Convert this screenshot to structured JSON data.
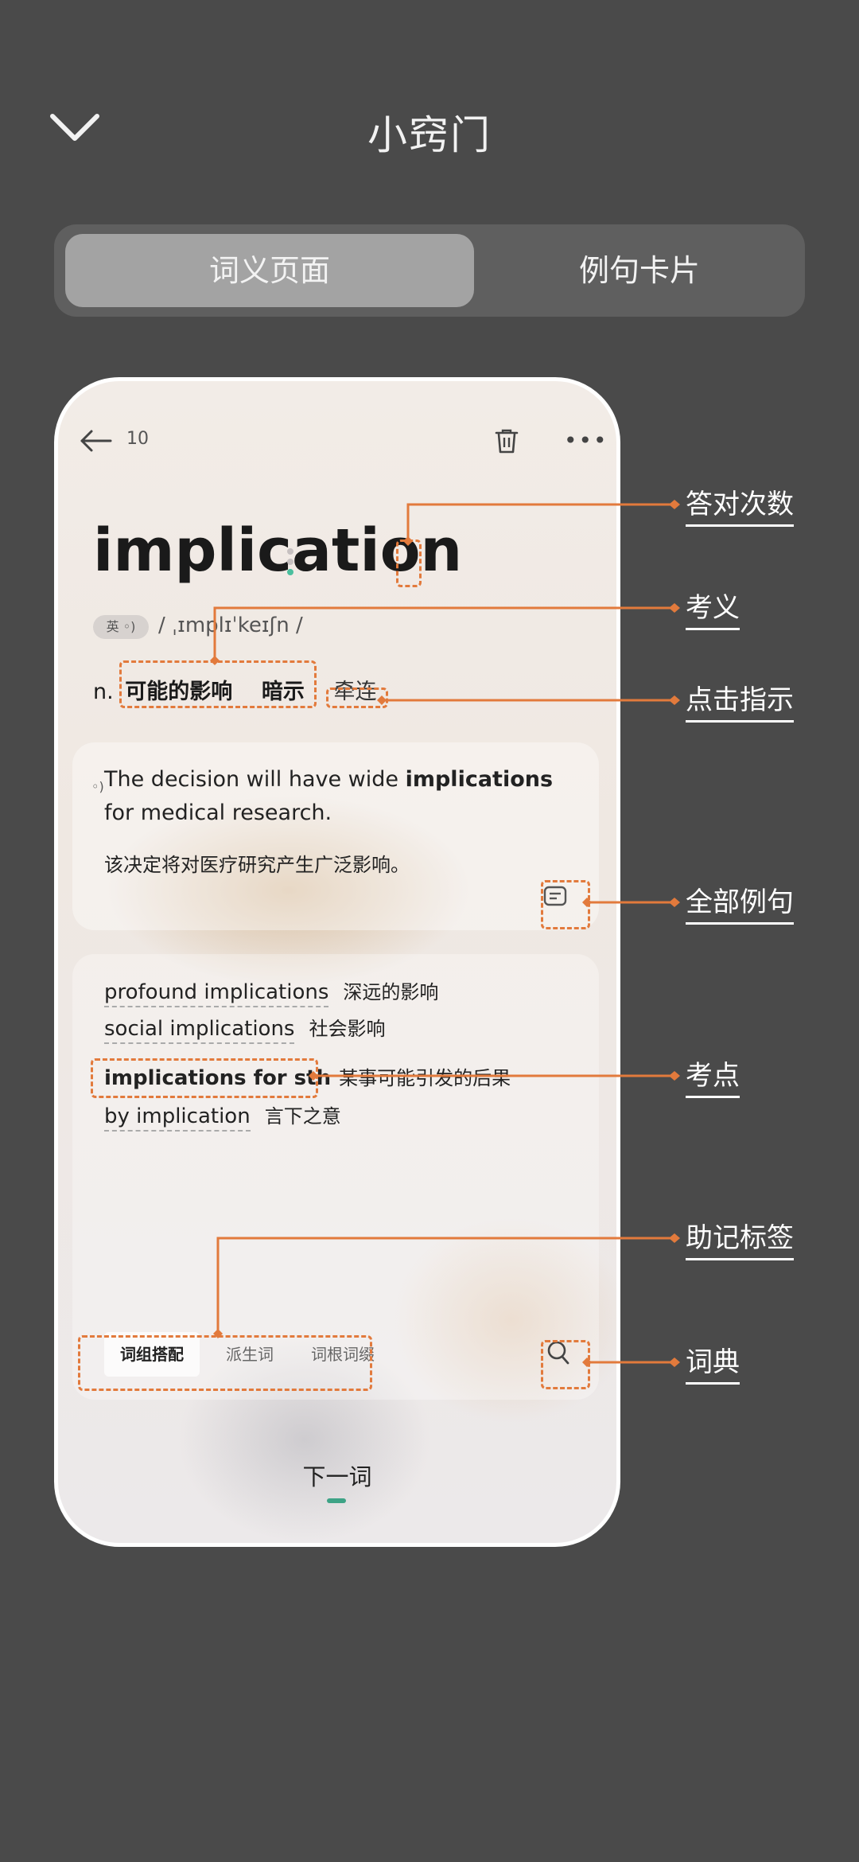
{
  "header": {
    "title": "小窍门"
  },
  "segments": {
    "active": "词义页面",
    "inactive": "例句卡片"
  },
  "phone": {
    "count": "10",
    "word": "implication",
    "lang_badge": "英 ◦)",
    "phonetic": "/ ˌɪmplɪˈkeɪʃn /",
    "pos": "n.",
    "definitions": [
      "可能的影响",
      "暗示",
      "牵连"
    ],
    "example": {
      "before": "The decision will have wide ",
      "highlight": "implications",
      "after": " for medical research.",
      "translation": "该决定将对医疗研究产生广泛影响。"
    },
    "phrases": [
      {
        "en": "profound implications",
        "cn": "深远的影响"
      },
      {
        "en": "social implications",
        "cn": "社会影响"
      },
      {
        "en": "implications for sth",
        "cn": "某事可能引发的后果"
      },
      {
        "en": "by implication",
        "cn": "言下之意"
      }
    ],
    "tabs": [
      "词组搭配",
      "派生词",
      "词根词缀"
    ],
    "next_word": "下一词"
  },
  "annotations": {
    "correct_count": "答对次数",
    "tested_meaning": "考义",
    "tap_hint": "点击指示",
    "all_examples": "全部例句",
    "test_point": "考点",
    "mnemonic_tags": "助记标签",
    "dictionary": "词典"
  },
  "colors": {
    "annotation": "#e27a3c",
    "accent_green": "#3ea386",
    "background": "#4a4a4a"
  }
}
